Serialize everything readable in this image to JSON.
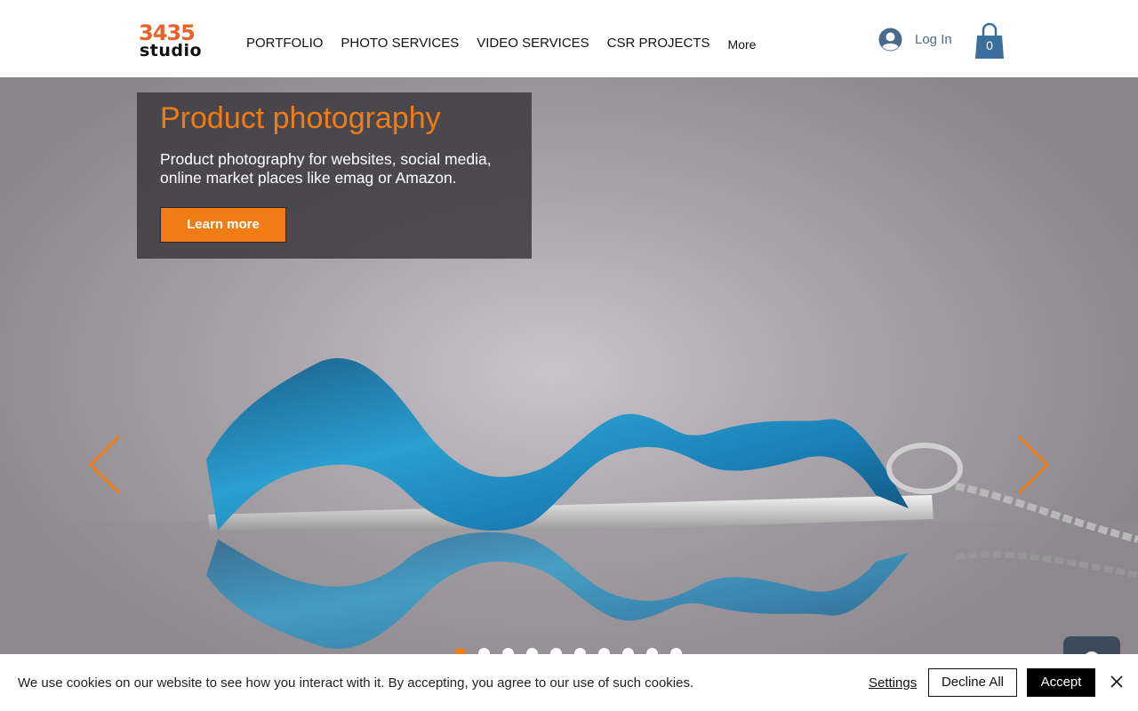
{
  "header": {
    "logo": {
      "number": "3435",
      "word": "studio"
    },
    "nav": [
      "PORTFOLIO",
      "PHOTO SERVICES",
      "VIDEO SERVICES",
      "CSR PROJECTS",
      "More"
    ],
    "login_label": "Log In",
    "cart_count": "0"
  },
  "hero": {
    "title": "Product photography",
    "description": "Product photography for websites, social media, online market places like emag or Amazon.",
    "button_label": "Learn more",
    "slide_count": 10,
    "active_slide": 1
  },
  "cookie_bar": {
    "message": "We use cookies on our website to see how you interact with it. By accepting, you agree to our use of such cookies.",
    "settings_label": "Settings",
    "decline_label": "Decline All",
    "accept_label": "Accept"
  },
  "colors": {
    "accent": "#f07c14",
    "logo_orange": "#e8622a",
    "link_blue": "#4a6a8a",
    "cart_blue": "#3a6f9e"
  },
  "icons": {
    "login": "user-avatar-icon",
    "cart": "shopping-bag-icon",
    "prev": "chevron-left-icon",
    "next": "chevron-right-icon",
    "close": "close-icon",
    "chat": "chat-icon"
  }
}
